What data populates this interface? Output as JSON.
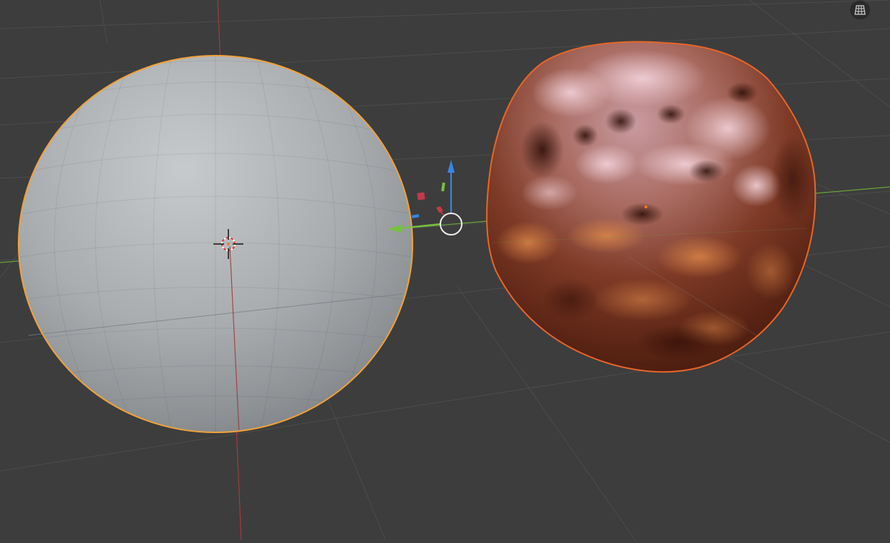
{
  "app": "3D Viewport",
  "viewport": {
    "background": "#3d3d3d",
    "grid_line_color": "#4a4a4a",
    "x_axis_color": "#a23a40",
    "y_axis_color": "#6aa33a"
  },
  "objects": [
    {
      "name": "smooth-sphere",
      "shading": "solid",
      "color": "#a9acae",
      "outline_color": "#f0a23c",
      "state": "selected"
    },
    {
      "name": "displaced-sphere",
      "shading": "material-preview",
      "color": "#8a3a22",
      "outline_color": "#e8662a",
      "state": "active"
    }
  ],
  "gizmos": {
    "transform_gizmo": {
      "z_axis_color": "#3a86e0",
      "y_axis_color": "#78c040",
      "x_plane_color": "#c23a48"
    },
    "cursor_3d": {
      "icon": "3d-cursor-icon"
    }
  },
  "header": {
    "grid_toggle_icon": "grid-icon"
  }
}
